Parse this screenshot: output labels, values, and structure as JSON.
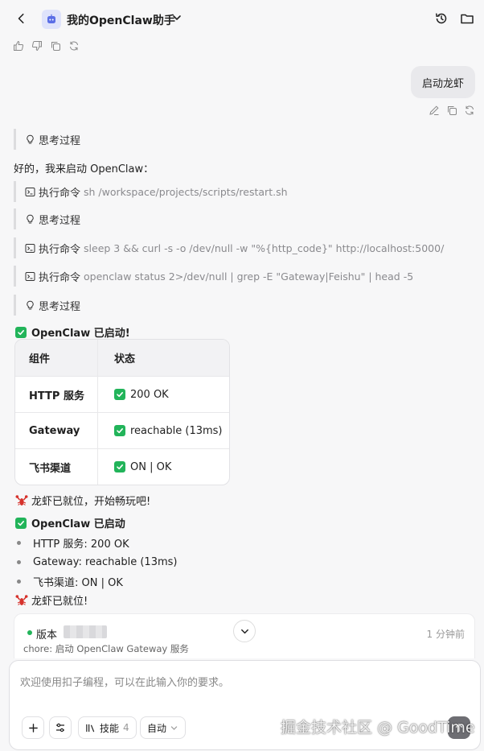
{
  "header": {
    "title": "我的OpenClaw助手"
  },
  "user_message": "启动龙虾",
  "assistant": {
    "thinking_label": "思考过程",
    "intro": "好的，我来启动 OpenClaw：",
    "exec_label": "执行命令",
    "commands": [
      "sh /workspace/projects/scripts/restart.sh",
      "sleep 3 && curl -s -o /dev/null -w \"%{http_code}\" http://localhost:5000/",
      "openclaw status 2>/dev/null | grep -E \"Gateway|Feishu\" | head -5"
    ],
    "started_heading": "OpenClaw 已启动!",
    "table": {
      "headers": [
        "组件",
        "状态"
      ],
      "rows": [
        [
          "HTTP 服务",
          "200 OK"
        ],
        [
          "Gateway",
          "reachable (13ms)"
        ],
        [
          "飞书渠道",
          "ON | OK"
        ]
      ]
    },
    "ready_line": "龙虾已就位，开始畅玩吧!",
    "summary_heading": "OpenClaw 已启动",
    "summary_items": [
      "HTTP 服务: 200 OK",
      "Gateway: reachable (13ms)",
      "飞书渠道: ON | OK"
    ],
    "ready_short": "龙虾已就位!"
  },
  "version": {
    "label": "版本",
    "time": "1 分钟前",
    "commit": "chore: 启动 OpenClaw Gateway 服务"
  },
  "composer": {
    "placeholder": "欢迎使用扣子编程，可以在此输入你的要求。",
    "skills_label": "技能",
    "skills_count": "4",
    "mode_label": "自动"
  },
  "watermark": "掘金技术社区 @ GoodTime",
  "colors": {
    "success": "#22b45a",
    "accent_lobster": "#d6322c"
  }
}
